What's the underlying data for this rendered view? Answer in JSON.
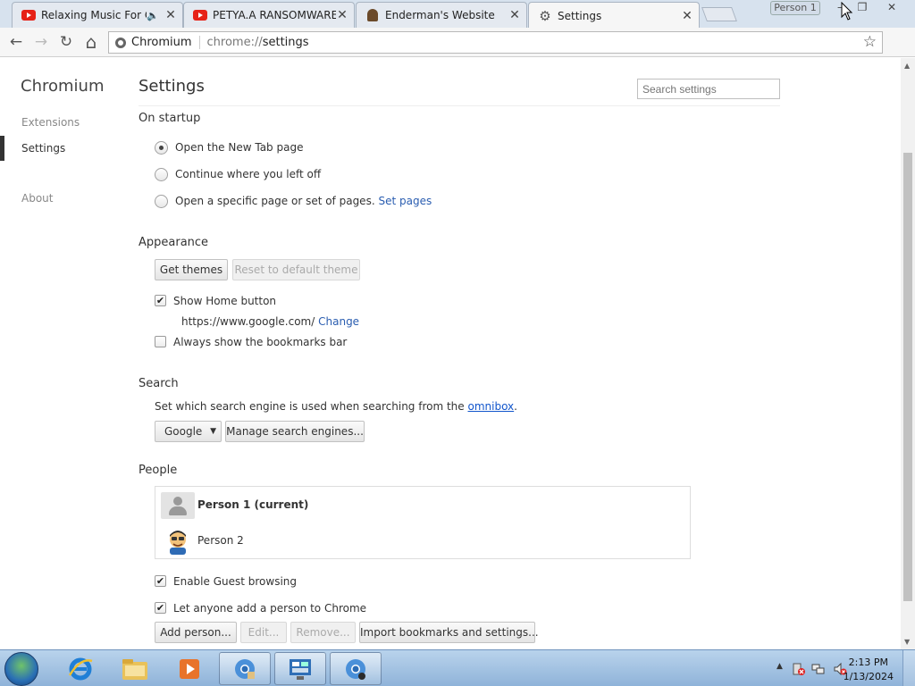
{
  "window": {
    "profile_label": "Person 1",
    "controls": {
      "minimize": "–",
      "restore": "❐",
      "close": "✕"
    }
  },
  "tabs": [
    {
      "title": "Relaxing Music For Ca",
      "icon": "youtube-icon",
      "audio": "🔈",
      "close": "✕"
    },
    {
      "title": "PETYA.A RANSOMWARE",
      "icon": "youtube-icon",
      "close": "✕"
    },
    {
      "title": "Enderman's Website",
      "icon": "site-favicon-icon",
      "close": "✕"
    },
    {
      "title": "Settings",
      "icon": "gear-icon",
      "close": "✕"
    }
  ],
  "toolbar": {
    "back": "←",
    "forward": "→",
    "reload": "↻",
    "home": "⌂",
    "site_name": "Chromium",
    "url_scheme": "chrome://",
    "url_path": "settings",
    "star": "☆"
  },
  "sidebar": {
    "brand": "Chromium",
    "items": [
      {
        "label": "Extensions"
      },
      {
        "label": "Settings"
      },
      {
        "label": "About"
      }
    ]
  },
  "main": {
    "title": "Settings",
    "search_placeholder": "Search settings",
    "startup": {
      "heading": "On startup",
      "options": [
        {
          "label": "Open the New Tab page",
          "selected": true
        },
        {
          "label": "Continue where you left off",
          "selected": false
        },
        {
          "label": "Open a specific page or set of pages.",
          "selected": false
        }
      ],
      "set_pages_link": "Set pages"
    },
    "appearance": {
      "heading": "Appearance",
      "get_themes": "Get themes",
      "reset_theme": "Reset to default theme",
      "show_home": {
        "label": "Show Home button",
        "checked": true
      },
      "home_url": "https://www.google.com/",
      "change_link": "Change",
      "bookmarks_bar": {
        "label": "Always show the bookmarks bar",
        "checked": false
      }
    },
    "search": {
      "heading": "Search",
      "description": "Set which search engine is used when searching from the",
      "omnibox_link": "omnibox",
      "period": ".",
      "engine": "Google",
      "manage": "Manage search engines..."
    },
    "people": {
      "heading": "People",
      "persons": [
        {
          "name": "Person 1 (current)",
          "current": true
        },
        {
          "name": "Person 2",
          "current": false
        }
      ],
      "guest": {
        "label": "Enable Guest browsing",
        "checked": true
      },
      "anyone_add": {
        "label": "Let anyone add a person to Chrome",
        "checked": true
      },
      "buttons": {
        "add": "Add person...",
        "edit": "Edit...",
        "remove": "Remove...",
        "import": "Import bookmarks and settings..."
      }
    }
  },
  "taskbar": {
    "time": "2:13 PM",
    "date": "1/13/2024",
    "tray_arrow": "▲"
  },
  "colors": {
    "link": "#2a5db0",
    "tabstrip": "#d7e2ee",
    "taskbar": "#8fb3d9"
  }
}
